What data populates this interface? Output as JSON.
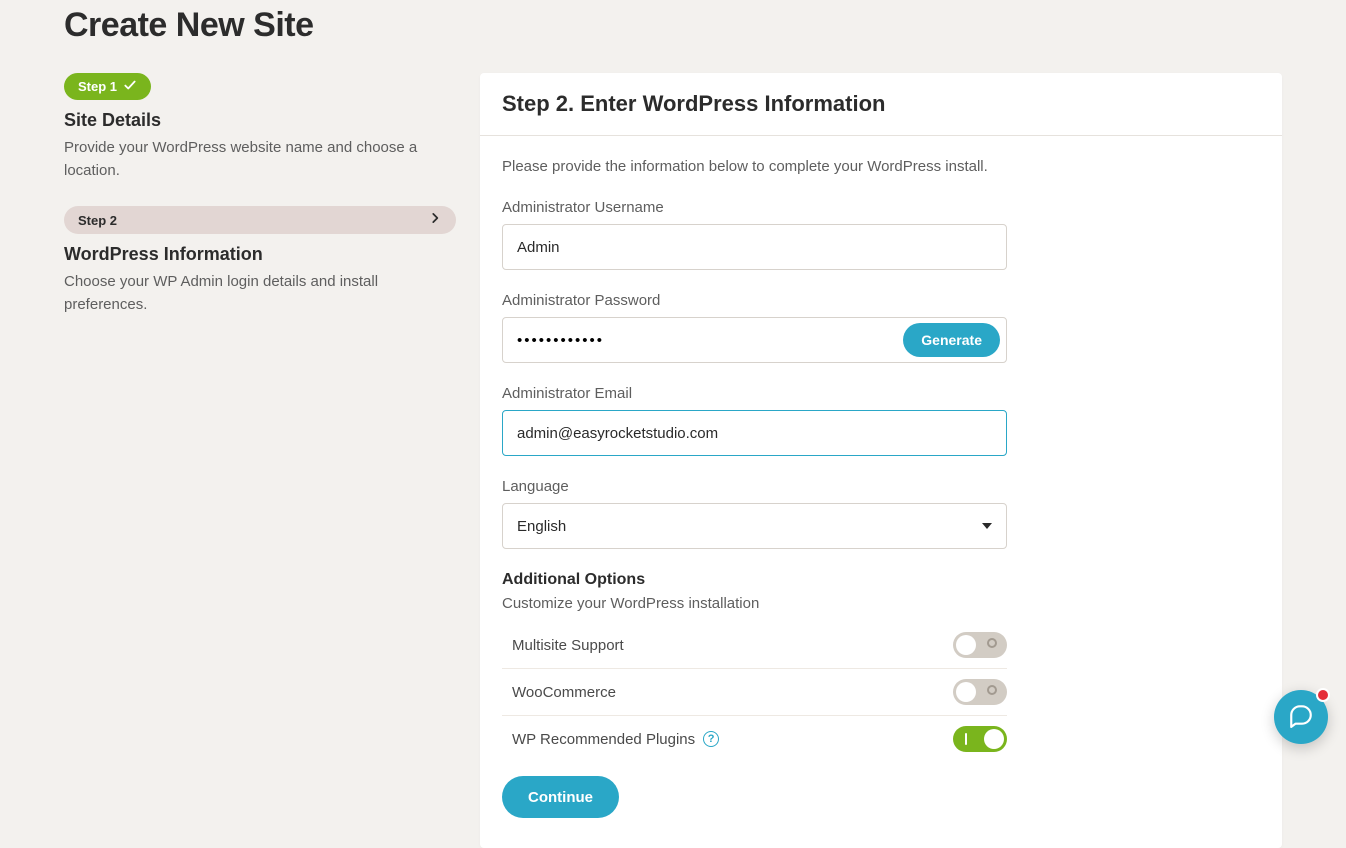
{
  "page_title": "Create New Site",
  "sidebar": {
    "step1": {
      "chip": "Step 1",
      "title": "Site Details",
      "desc": "Provide your WordPress website name and choose a location."
    },
    "step2": {
      "bar_label": "Step 2",
      "title": "WordPress Information",
      "desc": "Choose your WP Admin login details and install preferences."
    }
  },
  "main": {
    "heading": "Step 2. Enter WordPress Information",
    "intro": "Please provide the information below to complete your WordPress install.",
    "fields": {
      "username": {
        "label": "Administrator Username",
        "value": "Admin"
      },
      "password": {
        "label": "Administrator Password",
        "value": "••••••••••••",
        "generate_label": "Generate"
      },
      "email": {
        "label": "Administrator Email",
        "value": "admin@easyrocketstudio.com"
      },
      "language": {
        "label": "Language",
        "value": "English"
      }
    },
    "additional": {
      "heading": "Additional Options",
      "desc": "Customize your WordPress installation",
      "options": {
        "multisite": {
          "label": "Multisite Support",
          "on": false
        },
        "woocommerce": {
          "label": "WooCommerce",
          "on": false
        },
        "wp_plugins": {
          "label": "WP Recommended Plugins",
          "on": true
        }
      }
    },
    "continue_label": "Continue"
  }
}
